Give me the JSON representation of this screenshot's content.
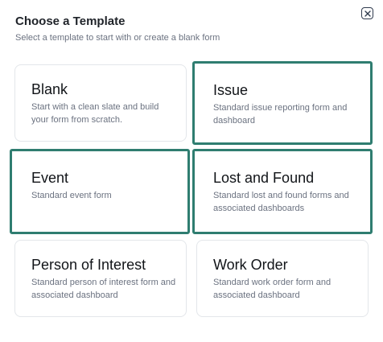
{
  "dialog": {
    "title": "Choose a Template",
    "subtitle": "Select a template to start with or create a blank form"
  },
  "templates": [
    {
      "title": "Blank",
      "description": "Start with a clean slate and build your form from scratch.",
      "selected": false
    },
    {
      "title": "Issue",
      "description": "Standard issue reporting form and dashboard",
      "selected": true
    },
    {
      "title": "Event",
      "description": "Standard event form",
      "selected": true
    },
    {
      "title": "Lost and Found",
      "description": "Standard lost and found forms and associated dashboards",
      "selected": true
    },
    {
      "title": "Person of Interest",
      "description": "Standard person of interest form and associated dashboard",
      "selected": false
    },
    {
      "title": "Work Order",
      "description": "Standard work order form and associated dashboard",
      "selected": false
    }
  ],
  "icons": {
    "close": "close-icon"
  },
  "colors": {
    "selected_border": "#2f7d70",
    "card_border": "#e3e6ea",
    "title_text": "#111418",
    "secondary_text": "#6b7280"
  }
}
